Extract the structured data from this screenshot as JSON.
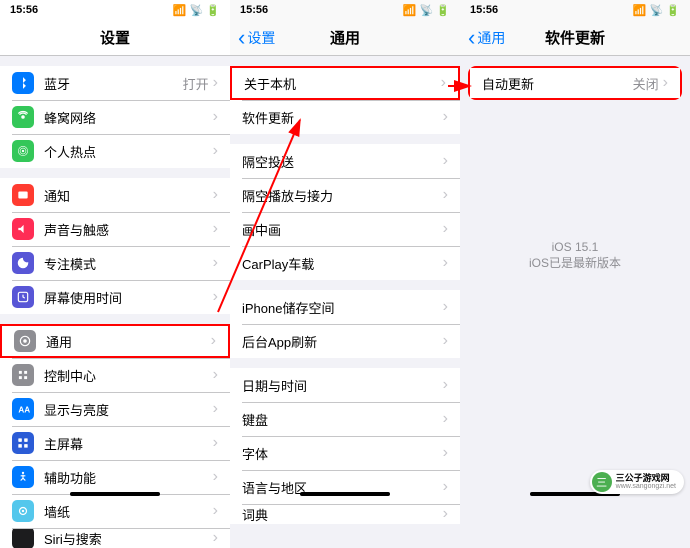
{
  "status": {
    "time": "15:56"
  },
  "screen1": {
    "title": "设置",
    "groups": [
      [
        {
          "icon": "bluetooth",
          "color": "#007aff",
          "label": "蓝牙",
          "value": "打开"
        },
        {
          "icon": "cellular",
          "color": "#34c759",
          "label": "蜂窝网络"
        },
        {
          "icon": "hotspot",
          "color": "#34c759",
          "label": "个人热点"
        }
      ],
      [
        {
          "icon": "notification",
          "color": "#ff3b30",
          "label": "通知"
        },
        {
          "icon": "sound",
          "color": "#ff2d55",
          "label": "声音与触感"
        },
        {
          "icon": "focus",
          "color": "#5856d6",
          "label": "专注模式"
        },
        {
          "icon": "screentime",
          "color": "#5856d6",
          "label": "屏幕使用时间"
        }
      ],
      [
        {
          "icon": "general",
          "color": "#8e8e93",
          "label": "通用",
          "highlight": true
        },
        {
          "icon": "control",
          "color": "#8e8e93",
          "label": "控制中心"
        },
        {
          "icon": "display",
          "color": "#007aff",
          "label": "显示与亮度"
        },
        {
          "icon": "home",
          "color": "#2b5cd6",
          "label": "主屏幕"
        },
        {
          "icon": "accessibility",
          "color": "#007aff",
          "label": "辅助功能"
        },
        {
          "icon": "wallpaper",
          "color": "#54c7ec",
          "label": "墙纸"
        },
        {
          "icon": "siri",
          "color": "#1c1c1e",
          "label": "Siri与搜索",
          "cut": true
        }
      ]
    ]
  },
  "screen2": {
    "back": "设置",
    "title": "通用",
    "groups": [
      [
        {
          "label": "关于本机",
          "highlight": true
        },
        {
          "label": "软件更新"
        }
      ],
      [
        {
          "label": "隔空投送"
        },
        {
          "label": "隔空播放与接力"
        },
        {
          "label": "画中画"
        },
        {
          "label": "CarPlay车载"
        }
      ],
      [
        {
          "label": "iPhone储存空间"
        },
        {
          "label": "后台App刷新"
        }
      ],
      [
        {
          "label": "日期与时间"
        },
        {
          "label": "键盘"
        },
        {
          "label": "字体"
        },
        {
          "label": "语言与地区"
        },
        {
          "label": "词典",
          "cut": true
        }
      ]
    ]
  },
  "screen3": {
    "back": "通用",
    "title": "软件更新",
    "groups": [
      [
        {
          "label": "自动更新",
          "value": "关闭",
          "highlight": true
        }
      ]
    ],
    "status": {
      "version": "iOS 15.1",
      "message": "iOS已是最新版本"
    }
  },
  "watermark": {
    "title": "三公子游戏网",
    "url": "www.sangongzi.net"
  }
}
